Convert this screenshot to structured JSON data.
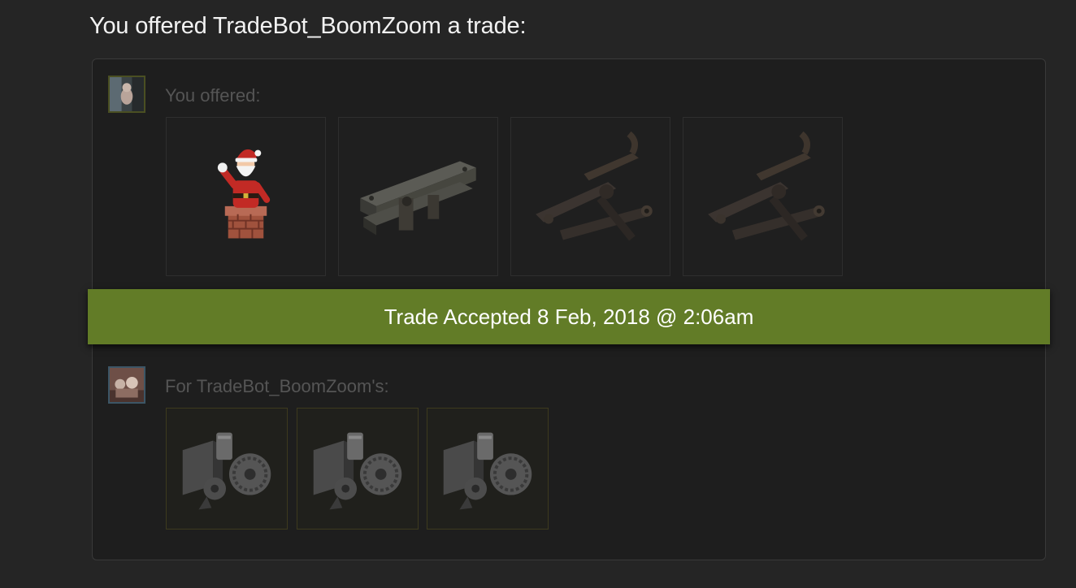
{
  "header": {
    "title": "You offered TradeBot_BoomZoom a trade:"
  },
  "offer": {
    "you_label": "You offered:",
    "you_items": [
      {
        "icon": "santa-chimney-icon"
      },
      {
        "icon": "metal-bars-icon"
      },
      {
        "icon": "scrap-parts-icon"
      },
      {
        "icon": "scrap-parts-icon"
      }
    ],
    "them_label": "For TradeBot_BoomZoom's:",
    "them_items": [
      {
        "icon": "machine-parts-icon"
      },
      {
        "icon": "machine-parts-icon"
      },
      {
        "icon": "machine-parts-icon"
      }
    ]
  },
  "status": {
    "text": "Trade Accepted 8 Feb, 2018 @ 2:06am",
    "color": "#627c27"
  }
}
